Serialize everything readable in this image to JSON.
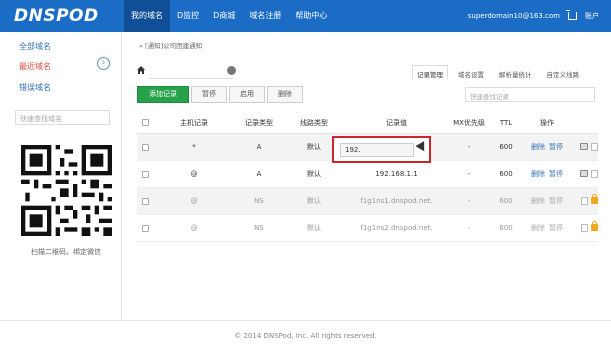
{
  "brand": {
    "logo": "DNSPOD",
    "accent": "#1b6cc4"
  },
  "nav": {
    "items": [
      "我的域名",
      "D监控",
      "D商城",
      "域名注册",
      "帮助中心"
    ],
    "active": 0
  },
  "account": {
    "email": "superdomain10@163.com",
    "menu_label": "账户",
    "cart_icon": "cart-icon"
  },
  "sidebar": {
    "all_domains": "全部域名",
    "recent_domains": "最近域名",
    "error_domains": "错误域名",
    "search_placeholder": "快速查找域名",
    "qr_caption": "扫描二维码，绑定微信"
  },
  "main": {
    "breadcrumb": "» [通知]公司团建通知",
    "tabs": [
      "记录管理",
      "域名设置",
      "解析量统计",
      "自定义线路"
    ],
    "active_tab": 0,
    "toolbar": {
      "add": "添加记录",
      "pause": "暂停",
      "enable": "启用",
      "delete": "删除"
    },
    "record_search_placeholder": "快速查找记录"
  },
  "table": {
    "headers": [
      "主机记录",
      "记录类型",
      "线路类型",
      "记录值",
      "MX优先级",
      "TTL",
      "操作"
    ],
    "rows": [
      {
        "host": "*",
        "type": "A",
        "line": "默认",
        "value": "",
        "mx": "-",
        "ttl": "600",
        "actions": [
          "删除",
          "暂停"
        ]
      },
      {
        "host": "@",
        "type": "A",
        "line": "默认",
        "value": "192.168.1.1",
        "mx": "-",
        "ttl": "600",
        "actions": [
          "删除",
          "暂停"
        ]
      },
      {
        "host": "@",
        "type": "NS",
        "line": "默认",
        "value": "f1g1ns1.dnspod.net.",
        "mx": "-",
        "ttl": "600",
        "actions": [
          "删除",
          "暂停"
        ]
      },
      {
        "host": "@",
        "type": "NS",
        "line": "默认",
        "value": "f1g1ns2.dnspod.net.",
        "mx": "-",
        "ttl": "600",
        "actions": [
          "删除",
          "暂停"
        ]
      }
    ],
    "editing_value": "192."
  },
  "footer": {
    "copyright": "© 2014 DNSPod, Inc. All rights reserved."
  }
}
